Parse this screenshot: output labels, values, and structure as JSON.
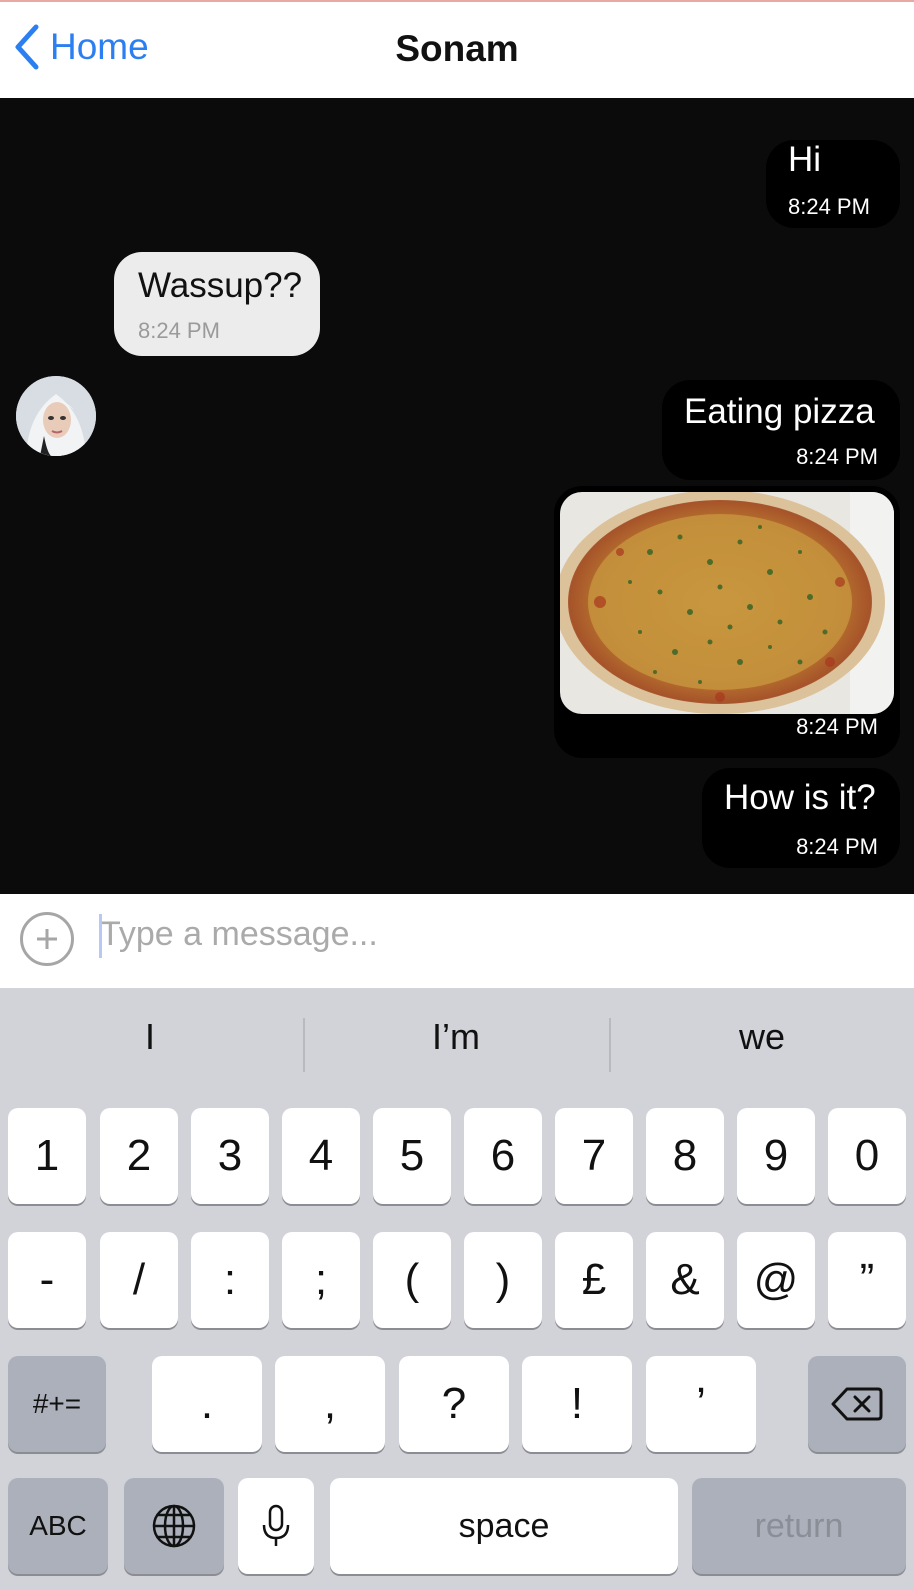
{
  "nav": {
    "back_label": "Home",
    "title": "Sonam"
  },
  "messages": [
    {
      "text": "Hi",
      "time": "8:24 PM",
      "direction": "outgoing"
    },
    {
      "text": "Wassup??",
      "time": "8:24 PM",
      "direction": "incoming"
    },
    {
      "text": "Eating pizza",
      "time": "8:24 PM",
      "direction": "outgoing"
    },
    {
      "image": "pizza-photo",
      "time": "8:24 PM",
      "direction": "outgoing"
    },
    {
      "text": "How is it?",
      "time": "8:24 PM",
      "direction": "outgoing"
    }
  ],
  "composer": {
    "placeholder": "Type a message...",
    "add_icon": "plus-circle-icon"
  },
  "keyboard": {
    "suggestions": [
      "I",
      "I’m",
      "we"
    ],
    "row1": [
      "1",
      "2",
      "3",
      "4",
      "5",
      "6",
      "7",
      "8",
      "9",
      "0"
    ],
    "row2": [
      "-",
      "/",
      ":",
      ";",
      "(",
      ")",
      "£",
      "&",
      "@",
      "”"
    ],
    "row3": [
      ".",
      ",",
      "?",
      "!",
      "’"
    ],
    "symbols_key": "#+=",
    "abc_key": "ABC",
    "space_key": "space",
    "return_key": "return"
  },
  "colors": {
    "accent": "#2b7ff0",
    "chat_background": "#0b0b0b",
    "keyboard_background": "#d1d3d9"
  }
}
